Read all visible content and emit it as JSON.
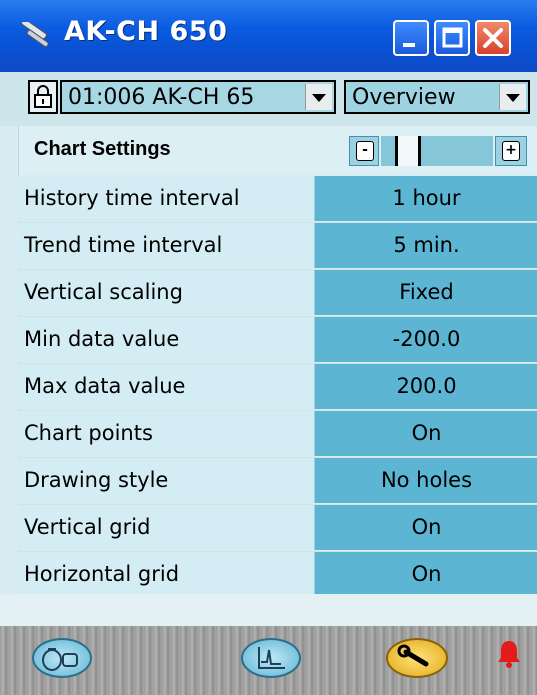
{
  "window": {
    "title": "AK-CH 650",
    "controls": [
      "minimize",
      "maximize",
      "close"
    ]
  },
  "toolbar": {
    "unit_selected": "01:006 AK-CH 65",
    "view_selected": "Overview"
  },
  "section": {
    "title": "Chart Settings"
  },
  "settings": [
    {
      "label": "History time interval",
      "value": "1 hour"
    },
    {
      "label": "Trend time interval",
      "value": "5 min."
    },
    {
      "label": "Vertical scaling",
      "value": "Fixed"
    },
    {
      "label": "Min data value",
      "value": "-200.0"
    },
    {
      "label": "Max data value",
      "value": "200.0"
    },
    {
      "label": "Chart points",
      "value": "On"
    },
    {
      "label": "Drawing style",
      "value": "No holes"
    },
    {
      "label": "Vertical grid",
      "value": "On"
    },
    {
      "label": "Horizontal grid",
      "value": "On"
    }
  ],
  "bottom_nav": {
    "items": [
      "overview-icon",
      "trend-chart-icon",
      "settings-wrench-icon",
      "alarm-bell-icon"
    ],
    "active": "settings-wrench-icon"
  },
  "colors": {
    "titlebar": "#0a5ae0",
    "value_cell": "#5bb5d3",
    "label_cell": "#d4edf4",
    "alarm": "#e31b1b"
  }
}
